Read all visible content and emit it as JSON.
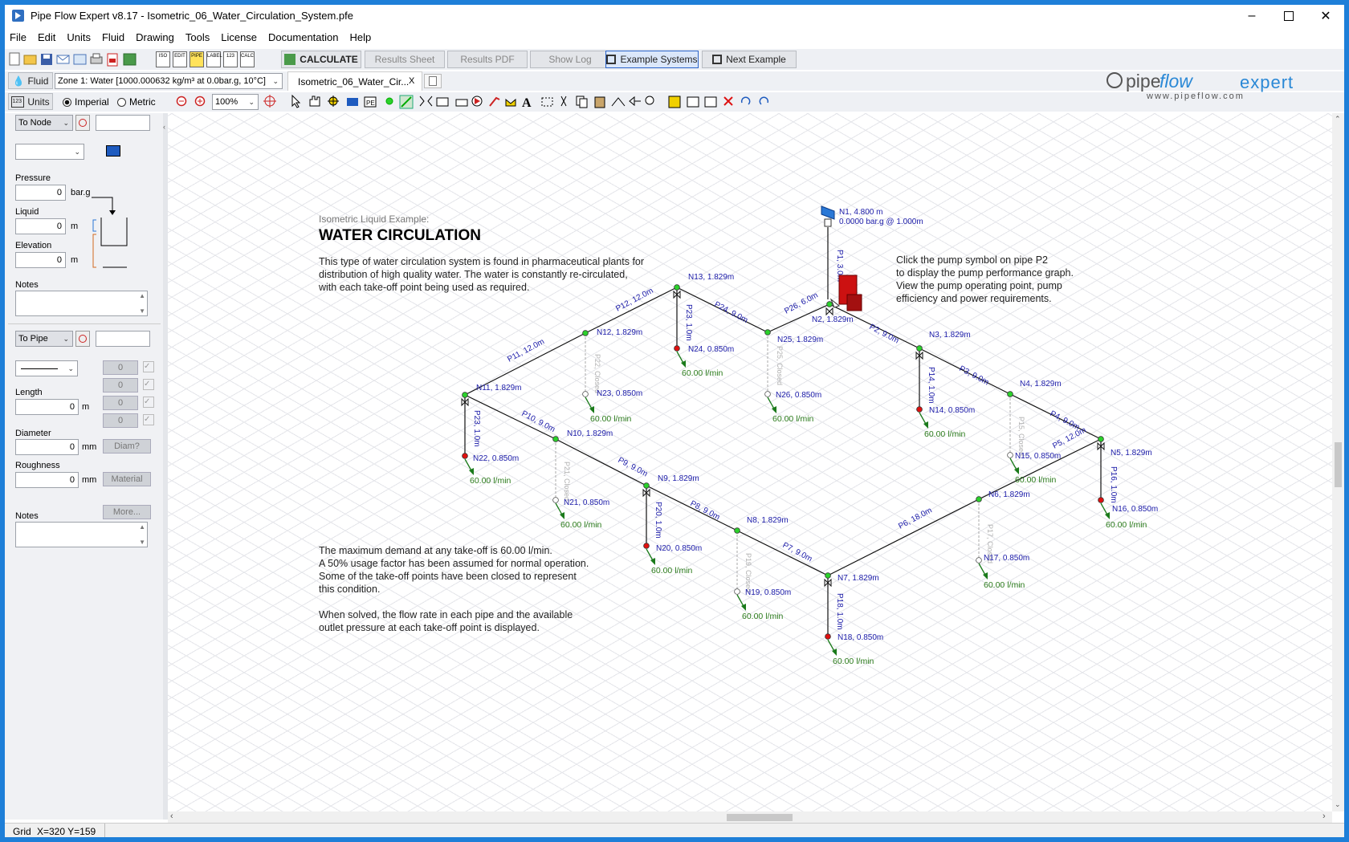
{
  "window": {
    "title": "Pipe Flow Expert v8.17 - Isometric_06_Water_Circulation_System.pfe"
  },
  "menu": [
    "File",
    "Edit",
    "Units",
    "Fluid",
    "Drawing",
    "Tools",
    "License",
    "Documentation",
    "Help"
  ],
  "toolbar": {
    "calculate": "CALCULATE",
    "results_sheet": "Results Sheet",
    "results_pdf": "Results PDF",
    "show_log": "Show Log",
    "example_systems": "Example Systems",
    "next_example": "Next Example",
    "icon_labels": [
      "ISO",
      "EDIT",
      "PIPE",
      "LABEL",
      "123",
      "CALC"
    ]
  },
  "fluidbar": {
    "fluid_button": "Fluid",
    "zone": "Zone 1: Water [1000.000632 kg/m³ at 0.0bar.g, 10°C]",
    "tab": "Isometric_06_Water_Cir...",
    "tab_close": "X"
  },
  "unitsbar": {
    "units_button": "Units",
    "imperial": "Imperial",
    "metric": "Metric",
    "zoom": "100%"
  },
  "brand": {
    "logo_a": "pipe",
    "logo_b": "flow",
    "logo_c": "expert",
    "url": "www.pipeflow.com"
  },
  "node_panel": {
    "to_node": "To Node",
    "pressure_label": "Pressure",
    "pressure_value": "0",
    "pressure_unit": "bar.g",
    "liquid_label": "Liquid",
    "liquid_value": "0",
    "liquid_unit": "m",
    "elevation_label": "Elevation",
    "elevation_value": "0",
    "elevation_unit": "m",
    "notes_label": "Notes"
  },
  "pipe_panel": {
    "to_pipe": "To Pipe",
    "fittings_counts": [
      "0",
      "0",
      "0",
      "0"
    ],
    "length_label": "Length",
    "length_value": "0",
    "length_unit": "m",
    "diameter_label": "Diameter",
    "diameter_value": "0",
    "diameter_unit": "mm",
    "diam_button": "Diam?",
    "roughness_label": "Roughness",
    "roughness_value": "0",
    "roughness_unit": "mm",
    "material_button": "Material",
    "more_button": "More...",
    "notes_label": "Notes"
  },
  "canvas": {
    "subtitle": "Isometric Liquid Example:",
    "heading": "WATER CIRCULATION",
    "intro": [
      "This type of water circulation system is found in pharmaceutical plants for",
      "distribution of high quality water. The water is constantly re-circulated,",
      "with each take-off point being used as required."
    ],
    "pump_note": [
      "Click the pump symbol on pipe P2",
      "to display the pump performance graph.",
      "View the pump operating point, pump",
      "efficiency and power requirements."
    ],
    "demand_note": [
      "The maximum demand at any take-off is 60.00 l/min.",
      "A 50% usage factor has been assumed for normal operation.",
      "Some of the take-off points have been closed to represent",
      "this condition.",
      "",
      "When solved, the flow rate in each pipe and the available",
      "outlet pressure at each take-off point is displayed."
    ],
    "tank_label": "N1, 4.800 m",
    "tank_pressure": "0.0000 bar.g @ 1.000m",
    "nodes": [
      {
        "label": "N2, 1.829m"
      },
      {
        "label": "N3, 1.829m"
      },
      {
        "label": "N4, 1.829m"
      },
      {
        "label": "N5, 1.829m"
      },
      {
        "label": "N6, 1.829m"
      },
      {
        "label": "N7, 1.829m"
      },
      {
        "label": "N8, 1.829m"
      },
      {
        "label": "N9, 1.829m"
      },
      {
        "label": "N10, 1.829m"
      },
      {
        "label": "N11, 1.829m"
      },
      {
        "label": "N12, 1.829m"
      },
      {
        "label": "N13, 1.829m"
      },
      {
        "label": "N25, 1.829m"
      },
      {
        "label": "N14, 0.850m"
      },
      {
        "label": "N15, 0.850m"
      },
      {
        "label": "N16, 0.850m"
      },
      {
        "label": "N17, 0.850m"
      },
      {
        "label": "N18, 0.850m"
      },
      {
        "label": "N19, 0.850m"
      },
      {
        "label": "N20, 0.850m"
      },
      {
        "label": "N21, 0.850m"
      },
      {
        "label": "N22, 0.850m"
      },
      {
        "label": "N23, 0.850m"
      },
      {
        "label": "N24, 0.850m"
      },
      {
        "label": "N26, 0.850m"
      }
    ],
    "pipes": [
      "P1, 3.0m",
      "P2, 9.0m",
      "P3, 9.0m",
      "P4, 9.0m",
      "P5, 12.0m",
      "P6, 18.0m",
      "P7, 9.0m",
      "P8, 9.0m",
      "P9, 9.0m",
      "P10, 9.0m",
      "P11, 12.0m",
      "P12, 12.0m",
      "P13, 1.0m",
      "P14, 1.0m",
      "P16, 1.0m",
      "P18, 1.0m",
      "P20, 1.0m",
      "P23, 1.0m",
      "P24, 9.0m",
      "P26, 6.0m"
    ],
    "closed_pipes": [
      "P15, Closed",
      "P17, Closed",
      "P19, Closed",
      "P21, Closed",
      "P22, Closed",
      "P25, Closed"
    ],
    "flow": "60.00 l/min"
  },
  "status": {
    "grid": "Grid",
    "coords": "X=320  Y=159"
  },
  "colors": {
    "node_green": "#2bd12b",
    "node_red": "#e01010",
    "label_blue": "#1a1aa8",
    "flow_green": "#2a7a1a",
    "pump_red": "#cc1111",
    "tank_blue": "#2a78d6"
  }
}
